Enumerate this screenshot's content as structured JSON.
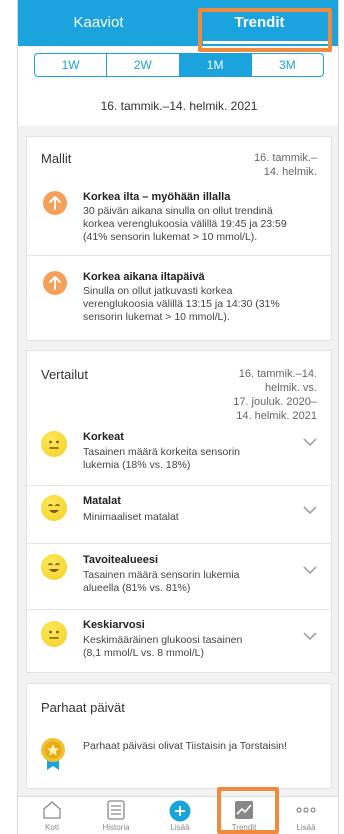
{
  "header": {
    "tabs": [
      {
        "label": "Kaaviot",
        "active": false
      },
      {
        "label": "Trendit",
        "active": true
      }
    ]
  },
  "period": {
    "options": [
      "1W",
      "2W",
      "1M",
      "3M"
    ],
    "selected": "1M"
  },
  "date_range": "16. tammik.–14. helmik. 2021",
  "patterns": {
    "title": "Mallit",
    "date_line1": "16. tammik.–",
    "date_line2": "14. helmik.",
    "items": [
      {
        "title": "Korkea ilta – myöhään illalla",
        "line1": "30 päivän aikana sinulla on ollut trendinä",
        "line2": "korkea verenglukoosia välillä 19:45 ja 23:59",
        "line3": "(41% sensorin lukemat > 10 mmol/L).",
        "icon": "arrow-up-icon"
      },
      {
        "title": "Korkea aikana iltapäivä",
        "line1": "Sinulla on ollut jatkuvasti korkea",
        "line2": "verenglukoosia välillä 13:15 ja 14:30 (31%",
        "line3": "sensorin lukemat > 10 mmol/L).",
        "icon": "arrow-up-icon"
      }
    ]
  },
  "comparisons": {
    "title": "Vertailut",
    "date_line1": "16. tammik.–14.",
    "date_line2": "helmik. vs.",
    "date_line3": "17. jouluk. 2020–",
    "date_line4": "14. helmik. 2021",
    "items": [
      {
        "title": "Korkeat",
        "line1": "Tasainen määrä korkeita sensorin",
        "line2": "lukemia (18% vs. 18%)",
        "icon": "neutral-face-icon"
      },
      {
        "title": "Matalat",
        "line1": "Minimaaliset matalat",
        "line2": "",
        "icon": "smiling-face-icon"
      },
      {
        "title": "Tavoitealueesi",
        "line1": "Tasainen määrä sensorin lukemia",
        "line2": "alueella (81% vs. 81%)",
        "icon": "smiling-face-icon"
      },
      {
        "title": "Keskiarvosi",
        "line1": "Keskimääräinen glukoosi tasainen",
        "line2": "(8,1 mmol/L vs. 8 mmol/L)",
        "icon": "neutral-face-icon"
      }
    ]
  },
  "best_days": {
    "title": "Parhaat päivät",
    "text": "Parhaat päiväsi olivat Tiistaisin ja Torstaisin!",
    "icon": "medal-icon"
  },
  "bottom_nav": [
    {
      "label": "Koti",
      "icon": "home-icon"
    },
    {
      "label": "Historia",
      "icon": "list-icon"
    },
    {
      "label": "Lisää",
      "icon": "plus-circle-icon"
    },
    {
      "label": "Trendit",
      "icon": "trend-chart-icon",
      "active": true
    },
    {
      "label": "Lisää",
      "icon": "more-dots-icon"
    }
  ],
  "colors": {
    "primary": "#1aa3dc",
    "highlight": "#f08a3c",
    "pattern_icon": "#f5a05a",
    "smiley": "#f2cf23"
  }
}
